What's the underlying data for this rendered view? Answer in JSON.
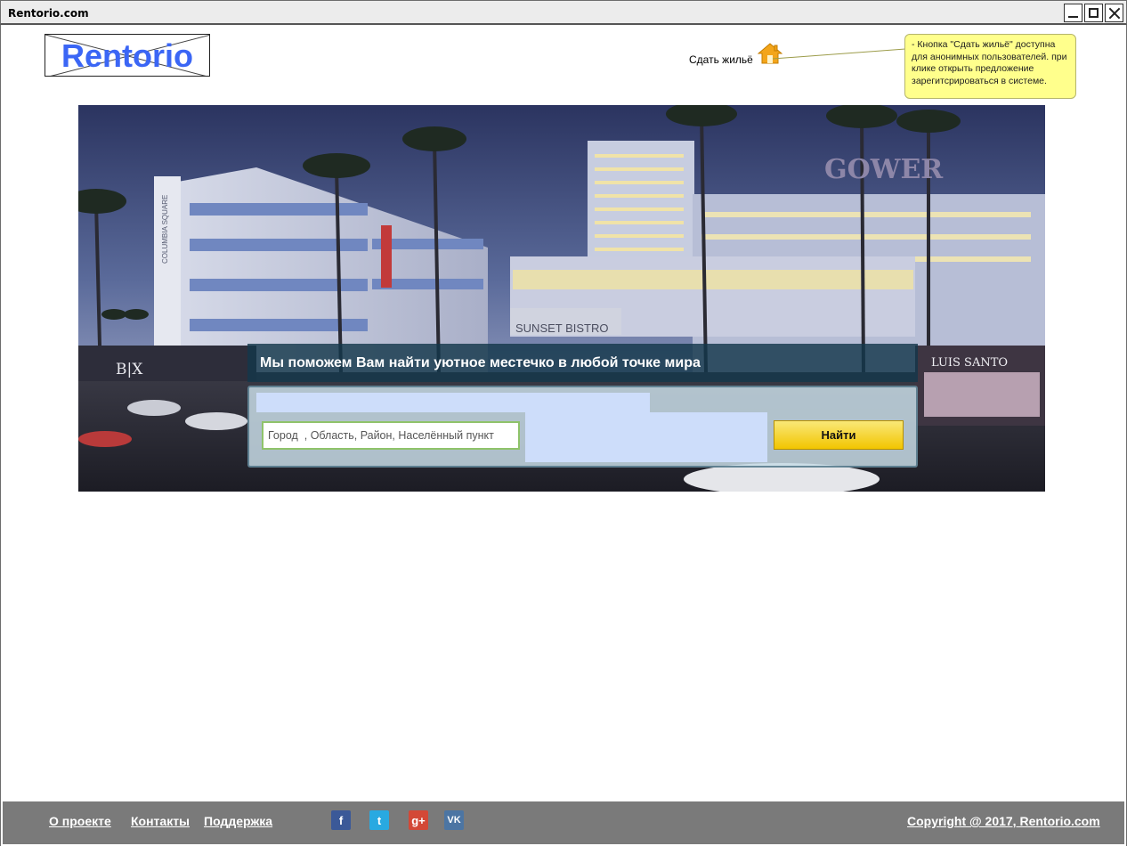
{
  "window": {
    "title": "Rentorio.com"
  },
  "header": {
    "logo_text": "Rentorio",
    "rent_link": "Сдать жильё",
    "home_icon": "home-icon"
  },
  "note": {
    "text": "- Кнопка \"Сдать жильё\" доступна для анонимных пользователей. при клике открыть предложение зарегитсрироваться в системе."
  },
  "hero": {
    "sign_gower": "GOWER",
    "sign_bistro": "SUNSET BISTRO",
    "sign_luis": "LUIS SANTO",
    "sign_bx": "B|X",
    "sign_columbia": "COLUMBIA SQUARE"
  },
  "search": {
    "title": "Мы поможем Вам найти уютное местечко в любой точке мира",
    "placeholder": "Город  , Область, Район, Населённый пункт",
    "button_label": "Найти"
  },
  "footer": {
    "links": [
      "О проекте",
      "Контакты",
      "Поддержка"
    ],
    "social": [
      {
        "icon": "facebook-icon",
        "glyph": "f",
        "color": "#3b5998"
      },
      {
        "icon": "twitter-icon",
        "glyph": "t",
        "color": "#29a9e1"
      },
      {
        "icon": "google-plus-icon",
        "glyph": "g+",
        "color": "#d34836"
      },
      {
        "icon": "vk-icon",
        "glyph": "VK",
        "color": "#4c75a3"
      }
    ],
    "copyright": "Copyright @ 2017, Rentorio.com"
  }
}
